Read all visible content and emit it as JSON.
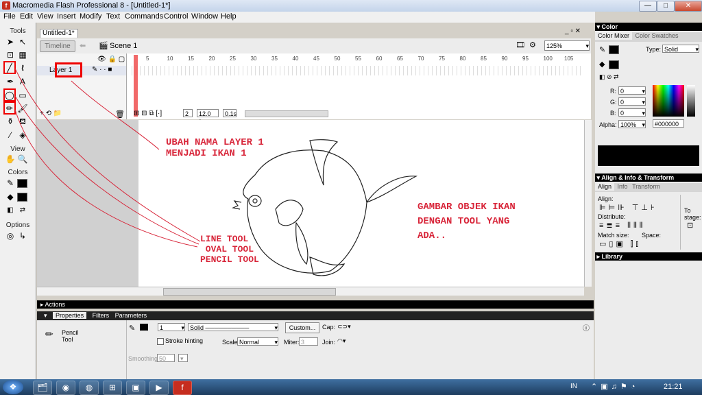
{
  "window": {
    "title": "Macromedia Flash Professional 8 - [Untitled-1*]",
    "min": "—",
    "max": "□",
    "close": "✕"
  },
  "menu": [
    "File",
    "Edit",
    "View",
    "Insert",
    "Modify",
    "Text",
    "Commands",
    "Control",
    "Window",
    "Help"
  ],
  "tools": {
    "header": "Tools",
    "view_label": "View",
    "colors_label": "Colors",
    "options_label": "Options"
  },
  "document": {
    "tab": "Untitled-1*",
    "timeline_button": "Timeline",
    "scene": "Scene 1",
    "zoom": "125%",
    "layer_name": "Layer 1",
    "frame_numbers": [
      "5",
      "10",
      "15",
      "20",
      "25",
      "30",
      "35",
      "40",
      "45",
      "50",
      "55",
      "60",
      "65",
      "70",
      "75",
      "80",
      "85",
      "90",
      "95",
      "100",
      "105"
    ],
    "current_frame": "2",
    "fps": "12.0 fps",
    "time": "0.1s"
  },
  "annotations": {
    "rename": "UBAH NAMA LAYER 1\nMENJADI IKAN 1",
    "tools": "LINE TOOL\n OVAL TOOL\nPENCIL TOOL",
    "draw": "GAMBAR OBJEK IKAN\nDENGAN TOOL YANG\nADA.."
  },
  "panels": {
    "actions": "Actions",
    "properties_tab": "Properties",
    "filters_tab": "Filters",
    "parameters_tab": "Parameters",
    "tool_name": "Pencil\nTool",
    "stroke_width": "1",
    "stroke_style": "Solid",
    "custom_button": "Custom...",
    "cap_label": "Cap:",
    "stroke_hinting": "Stroke hinting",
    "scale_label": "Scale:",
    "scale_value": "Normal",
    "miter_label": "Miter:",
    "miter_value": "3",
    "join_label": "Join:",
    "smoothing_label": "Smoothing",
    "smoothing_value": "50"
  },
  "color_panel": {
    "header": "Color",
    "tab_mixer": "Color Mixer",
    "tab_swatches": "Color Swatches",
    "type_label": "Type:",
    "type_value": "Solid",
    "r_label": "R:",
    "r_value": "0",
    "g_label": "G:",
    "g_value": "0",
    "b_label": "B:",
    "b_value": "0",
    "alpha_label": "Alpha:",
    "alpha_value": "100%",
    "hex": "#000000"
  },
  "align_panel": {
    "header": "Align & Info & Transform",
    "tab_align": "Align",
    "tab_info": "Info",
    "tab_transform": "Transform",
    "align_label": "Align:",
    "distribute_label": "Distribute:",
    "match_label": "Match size:",
    "space_label": "Space:",
    "to_stage": "To\nstage:"
  },
  "library_header": "Library",
  "taskbar": {
    "lang": "IN",
    "time": "21:21"
  },
  "colors": {
    "accent_red": "#e00000",
    "annotation_red": "#d8263a"
  }
}
